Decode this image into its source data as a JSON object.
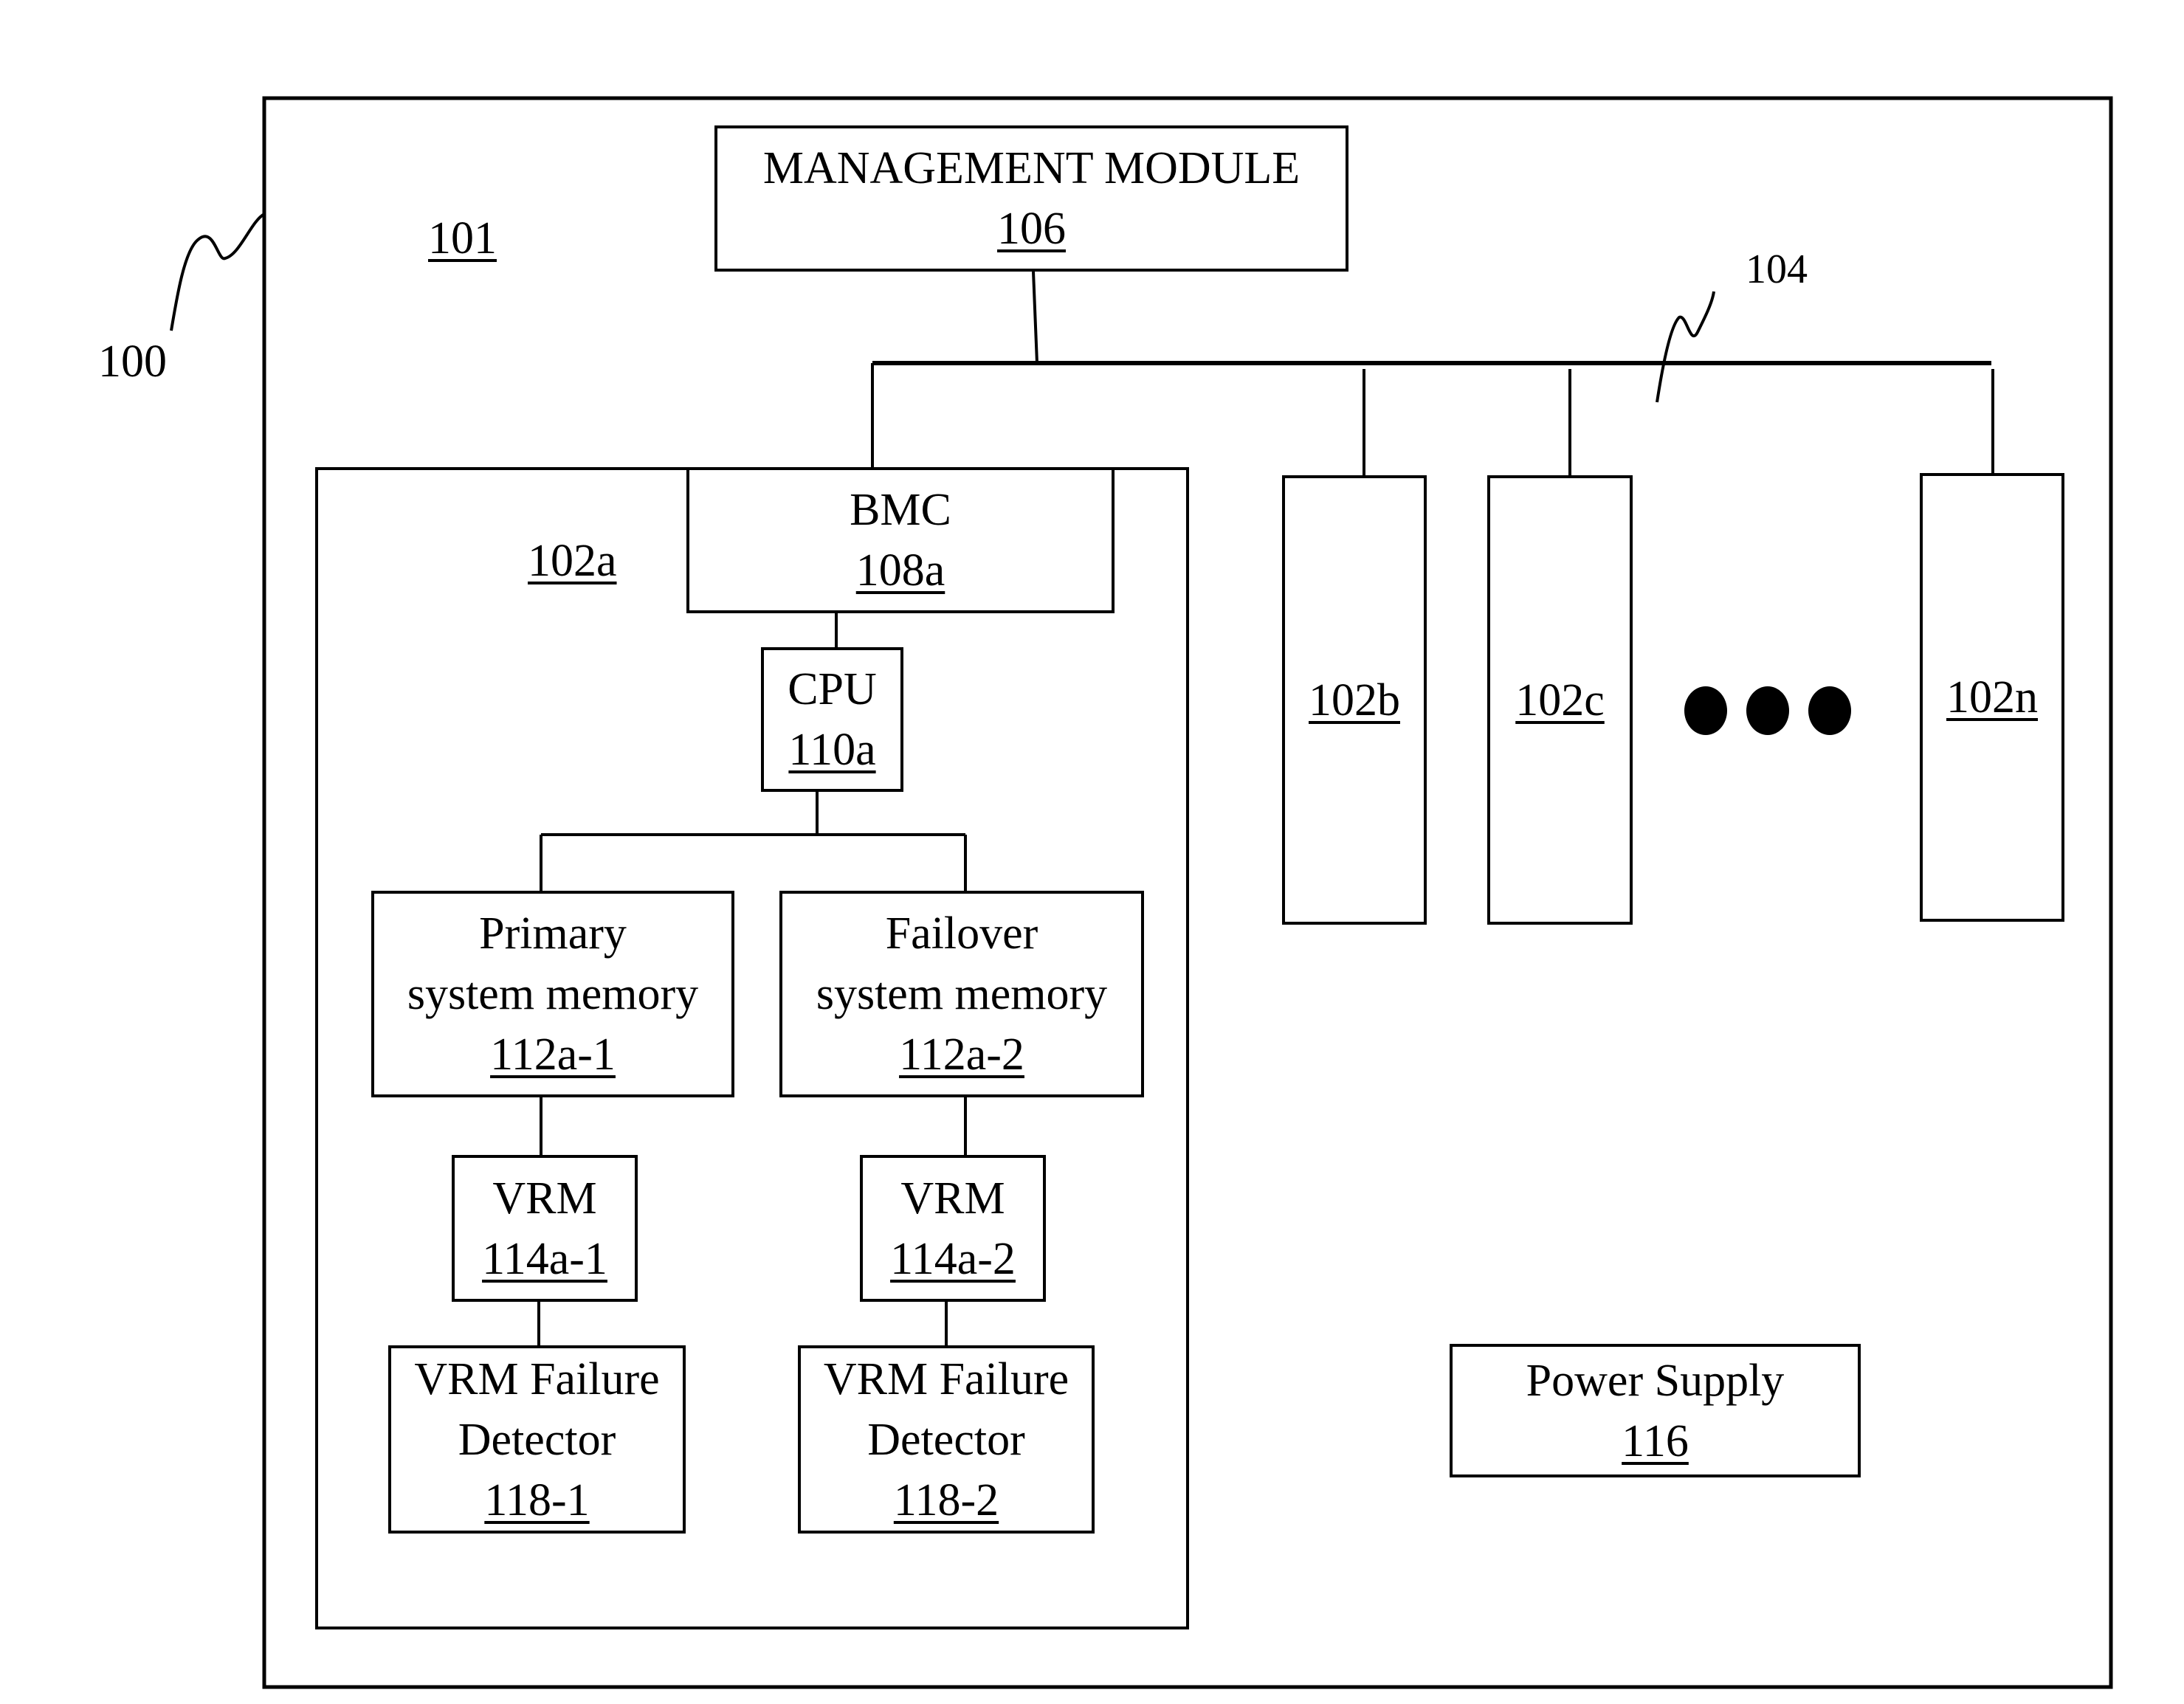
{
  "figure": {
    "system_ref": "100",
    "chassis_ref": "101",
    "bus_ref": "104",
    "management_module": {
      "title": "MANAGEMENT MODULE",
      "ref": "106"
    },
    "node_a": {
      "ref": "102a",
      "bmc": {
        "title": "BMC",
        "ref": "108a"
      },
      "cpu": {
        "title": "CPU",
        "ref": "110a"
      },
      "primary_memory": {
        "line1": "Primary",
        "line2": "system memory",
        "ref": "112a-1"
      },
      "failover_memory": {
        "line1": "Failover",
        "line2": "system memory",
        "ref": "112a-2"
      },
      "vrm1": {
        "title": "VRM",
        "ref": "114a-1"
      },
      "vrm2": {
        "title": "VRM",
        "ref": "114a-2"
      },
      "detector1": {
        "line1": "VRM Failure",
        "line2": "Detector",
        "ref": "118-1"
      },
      "detector2": {
        "line1": "VRM Failure",
        "line2": "Detector",
        "ref": "118-2"
      }
    },
    "other_nodes": [
      "102b",
      "102c",
      "102n"
    ],
    "ellipsis_icon": "three-dots",
    "power_supply": {
      "title": "Power Supply",
      "ref": "116"
    }
  }
}
